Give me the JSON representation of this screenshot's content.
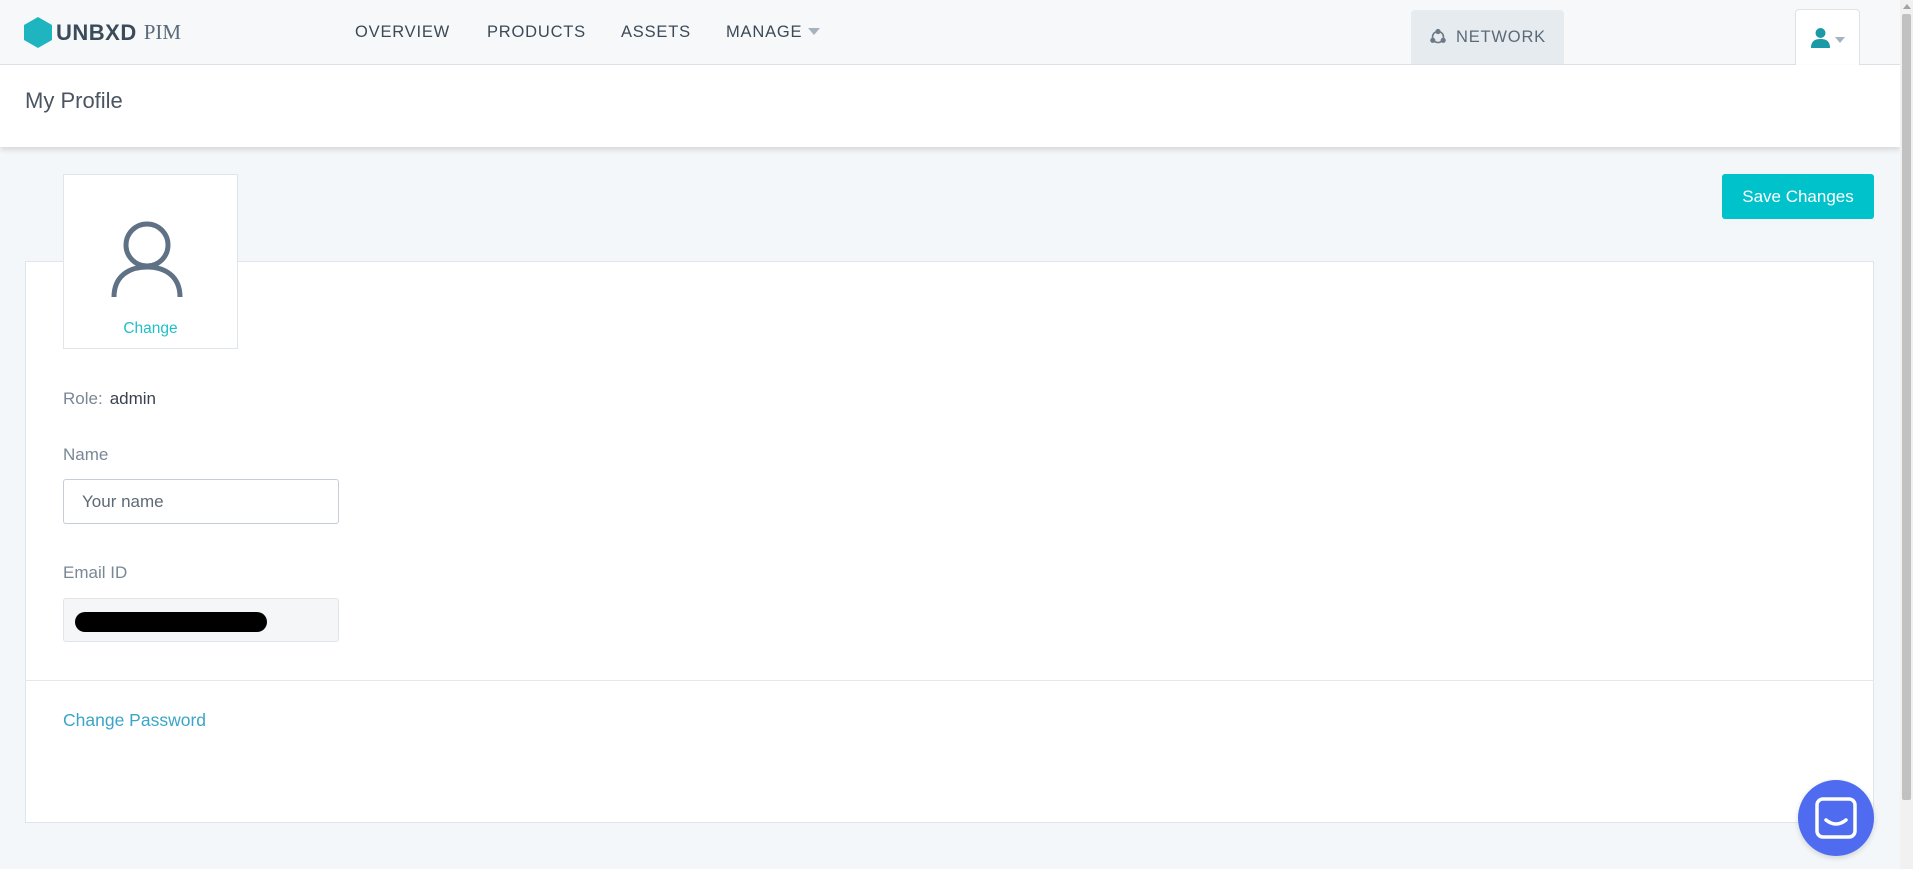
{
  "brand": {
    "name": "UNBXD",
    "product": "PIM"
  },
  "nav": {
    "overview": "OVERVIEW",
    "products": "PRODUCTS",
    "assets": "ASSETS",
    "manage": "MANAGE",
    "network": "NETWORK"
  },
  "page": {
    "title": "My Profile"
  },
  "actions": {
    "save_label": "Save Changes"
  },
  "profile": {
    "avatar_change_label": "Change",
    "role_label": "Role:",
    "role_value": "admin",
    "name_label": "Name",
    "name_placeholder": "Your name",
    "name_value": "",
    "email_label": "Email ID",
    "change_password_label": "Change Password"
  },
  "colors": {
    "accent": "#00c2cb",
    "link": "#3aa5c8",
    "chat": "#4f6cf0",
    "brand_hex": "#1fb5c0"
  },
  "icons": {
    "logo": "hexagon-logo-icon",
    "network": "network-icon",
    "user": "user-icon",
    "avatar": "person-outline-icon",
    "chat": "chat-icon"
  }
}
